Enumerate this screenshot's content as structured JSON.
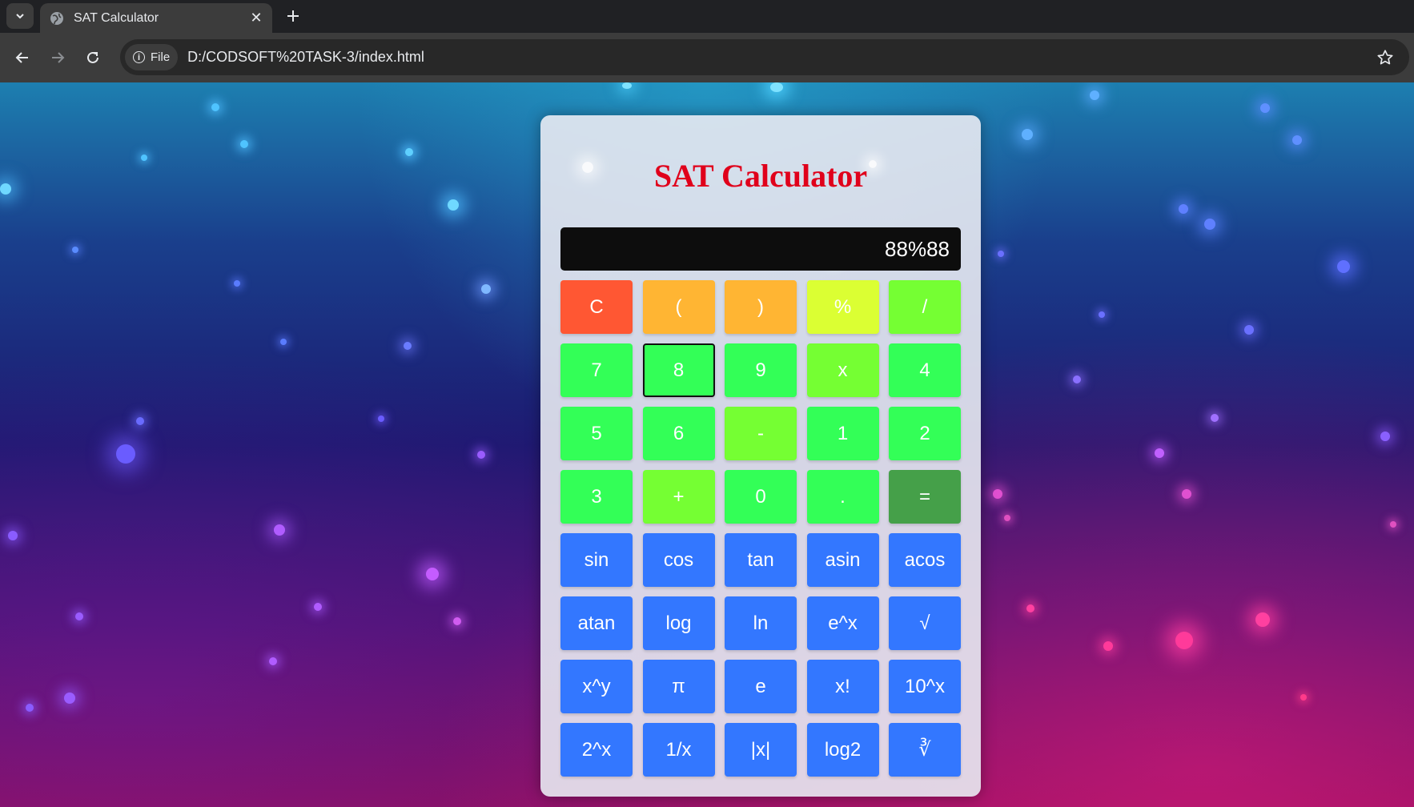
{
  "browser": {
    "tab_title": "SAT Calculator",
    "site_chip_label": "File",
    "url": "D:/CODSOFT%20TASK-3/index.html",
    "icons": [
      "tab-list-chevron-icon",
      "globe-icon",
      "close-icon",
      "plus-icon",
      "back-arrow-icon",
      "forward-arrow-icon",
      "reload-icon",
      "info-icon",
      "star-icon"
    ]
  },
  "calculator": {
    "title": "SAT Calculator",
    "display_value": "88%88",
    "title_color": "#e0001b",
    "keys": [
      {
        "label": "C",
        "color": "red"
      },
      {
        "label": "(",
        "color": "orange"
      },
      {
        "label": ")",
        "color": "orange"
      },
      {
        "label": "%",
        "color": "yellow"
      },
      {
        "label": "/",
        "color": "lime"
      },
      {
        "label": "7",
        "color": "green"
      },
      {
        "label": "8",
        "color": "green",
        "focused": true
      },
      {
        "label": "9",
        "color": "green"
      },
      {
        "label": "x",
        "color": "lime"
      },
      {
        "label": "4",
        "color": "green"
      },
      {
        "label": "5",
        "color": "green"
      },
      {
        "label": "6",
        "color": "green"
      },
      {
        "label": "-",
        "color": "lime"
      },
      {
        "label": "1",
        "color": "green"
      },
      {
        "label": "2",
        "color": "green"
      },
      {
        "label": "3",
        "color": "green"
      },
      {
        "label": "+",
        "color": "lime"
      },
      {
        "label": "0",
        "color": "green"
      },
      {
        "label": ".",
        "color": "green"
      },
      {
        "label": "=",
        "color": "dark"
      },
      {
        "label": "sin",
        "color": "blue"
      },
      {
        "label": "cos",
        "color": "blue"
      },
      {
        "label": "tan",
        "color": "blue"
      },
      {
        "label": "asin",
        "color": "blue"
      },
      {
        "label": "acos",
        "color": "blue"
      },
      {
        "label": "atan",
        "color": "blue"
      },
      {
        "label": "log",
        "color": "blue"
      },
      {
        "label": "ln",
        "color": "blue"
      },
      {
        "label": "e^x",
        "color": "blue"
      },
      {
        "label": "√",
        "color": "blue"
      },
      {
        "label": "x^y",
        "color": "blue"
      },
      {
        "label": "π",
        "color": "blue"
      },
      {
        "label": "e",
        "color": "blue"
      },
      {
        "label": "x!",
        "color": "blue"
      },
      {
        "label": "10^x",
        "color": "blue"
      },
      {
        "label": "2^x",
        "color": "blue"
      },
      {
        "label": "1/x",
        "color": "blue"
      },
      {
        "label": "|x|",
        "color": "blue"
      },
      {
        "label": "log2",
        "color": "blue"
      },
      {
        "label": "∛",
        "color": "blue"
      }
    ]
  }
}
